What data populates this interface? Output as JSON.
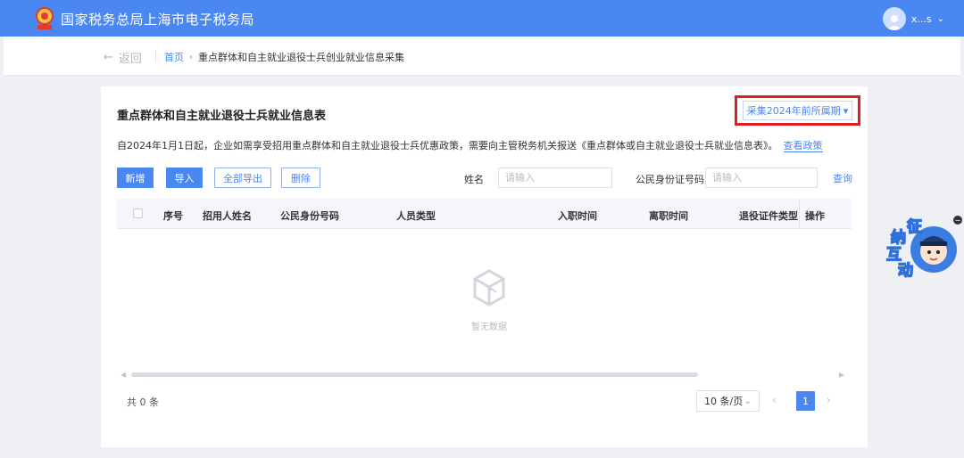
{
  "header": {
    "site_title": "国家税务总局上海市电子税务局",
    "username": "x...s",
    "brand_color": "#4b87f0"
  },
  "nav": {
    "back_label": "返回",
    "breadcrumb_home": "首页",
    "breadcrumb_current": "重点群体和自主就业退役士兵创业就业信息采集"
  },
  "card": {
    "title": "重点群体和自主就业退役士兵就业信息表",
    "period_button": "采集2024年前所属期",
    "notice_text": "自2024年1月1日起，企业如需享受招用重点群体和自主就业退役士兵优惠政策，需要向主管税务机关报送《重点群体或自主就业退役士兵就业信息表》。",
    "notice_link": "查看政策"
  },
  "toolbar": {
    "add": "新增",
    "import": "导入",
    "export_all": "全部导出",
    "delete": "删除",
    "name_label": "姓名",
    "name_placeholder": "请输入",
    "id_label": "公民身份证号码",
    "id_placeholder": "请输入",
    "query": "查询"
  },
  "table": {
    "columns": [
      "序号",
      "招用人姓名",
      "公民身份号码",
      "人员类型",
      "入职时间",
      "离职时间",
      "退役证件类型",
      "操作"
    ],
    "empty_text": "暂无数据"
  },
  "pagination": {
    "total": "共 0 条",
    "page_size": "10 条/页",
    "current_page": "1"
  },
  "widget": {
    "chars": [
      "征",
      "纳",
      "互",
      "动"
    ]
  }
}
